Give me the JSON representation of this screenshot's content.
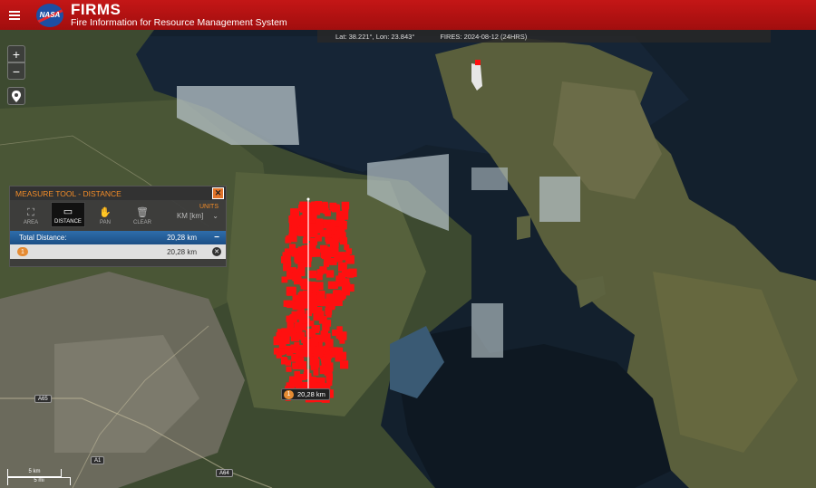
{
  "header": {
    "logo_text": "NASA",
    "app_name": "FIRMS",
    "app_subtitle": "Fire Information for Resource Management System"
  },
  "infobar": {
    "coords": "Lat: 38.221°, Lon: 23.843°",
    "fires": "FIRES: 2024-08-12 (24HRS)"
  },
  "map_controls": {
    "zoom_in": "+",
    "zoom_out": "−"
  },
  "measure_tool": {
    "title": "MEASURE TOOL - DISTANCE",
    "close": "✕",
    "tools": [
      {
        "label": "AREA",
        "icon": "area-icon"
      },
      {
        "label": "DISTANCE",
        "icon": "ruler-icon"
      },
      {
        "label": "PAN",
        "icon": "hand-icon"
      },
      {
        "label": "CLEAR",
        "icon": "trash-icon"
      }
    ],
    "units_label": "UNITS",
    "units_value": "KM [km]",
    "total_label": "Total Distance:",
    "total_value": "20,28 km",
    "segments": [
      {
        "index": "1",
        "value": "20,28 km"
      }
    ]
  },
  "map_label": {
    "index": "1",
    "value": "20,28 km"
  },
  "roads": {
    "a65": "A65",
    "a1": "A1",
    "a64": "A64"
  },
  "scale": {
    "km": "5 km",
    "mi": "5 mi"
  },
  "colors": {
    "header": "#b01212",
    "accent": "#f28c28",
    "fire": "#ff1010",
    "selection": "#2e6dab"
  }
}
